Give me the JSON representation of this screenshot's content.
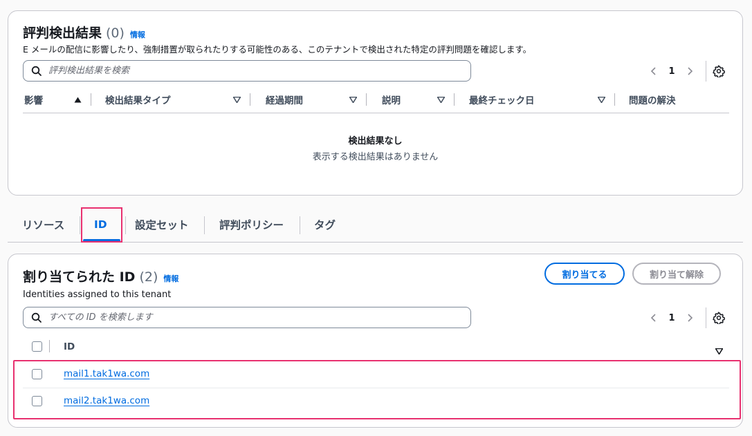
{
  "findings": {
    "title": "評判検出結果",
    "count": "(0)",
    "info": "情報",
    "description": "E メールの配信に影響したり、強制措置が取られたりする可能性のある、このテナントで検出された特定の評判問題を確認します。",
    "search_placeholder": "評判検出結果を検索",
    "page": "1",
    "columns": [
      "影響",
      "検出結果タイプ",
      "経過期間",
      "説明",
      "最終チェック日",
      "問題の解決"
    ],
    "sort_active_column": "影響",
    "empty_title": "検出結果なし",
    "empty_subtitle": "表示する検出結果はありません"
  },
  "tabs": [
    {
      "label": "リソース",
      "active": false
    },
    {
      "label": "ID",
      "active": true
    },
    {
      "label": "設定セット",
      "active": false
    },
    {
      "label": "評判ポリシー",
      "active": false
    },
    {
      "label": "タグ",
      "active": false
    }
  ],
  "assigned": {
    "title": "割り当てられた ID",
    "count": "(2)",
    "info": "情報",
    "description": "Identities assigned to this tenant",
    "assign_button": "割り当てる",
    "unassign_button": "割り当て解除",
    "search_placeholder": "すべての ID を検索します",
    "page": "1",
    "column": "ID",
    "rows": [
      {
        "identity": "mail1.tak1wa.com",
        "checked": false
      },
      {
        "identity": "mail2.tak1wa.com",
        "checked": false
      }
    ]
  },
  "colors": {
    "accent": "#006ce0",
    "highlight": "#e8306f",
    "border": "#c6c6cd",
    "text": "#16191f",
    "muted": "#414d5c"
  },
  "icons": [
    "search-icon",
    "chevron-left-icon",
    "chevron-right-icon",
    "settings-gear-icon",
    "sort-ascending-icon",
    "sort-descending-icon"
  ]
}
